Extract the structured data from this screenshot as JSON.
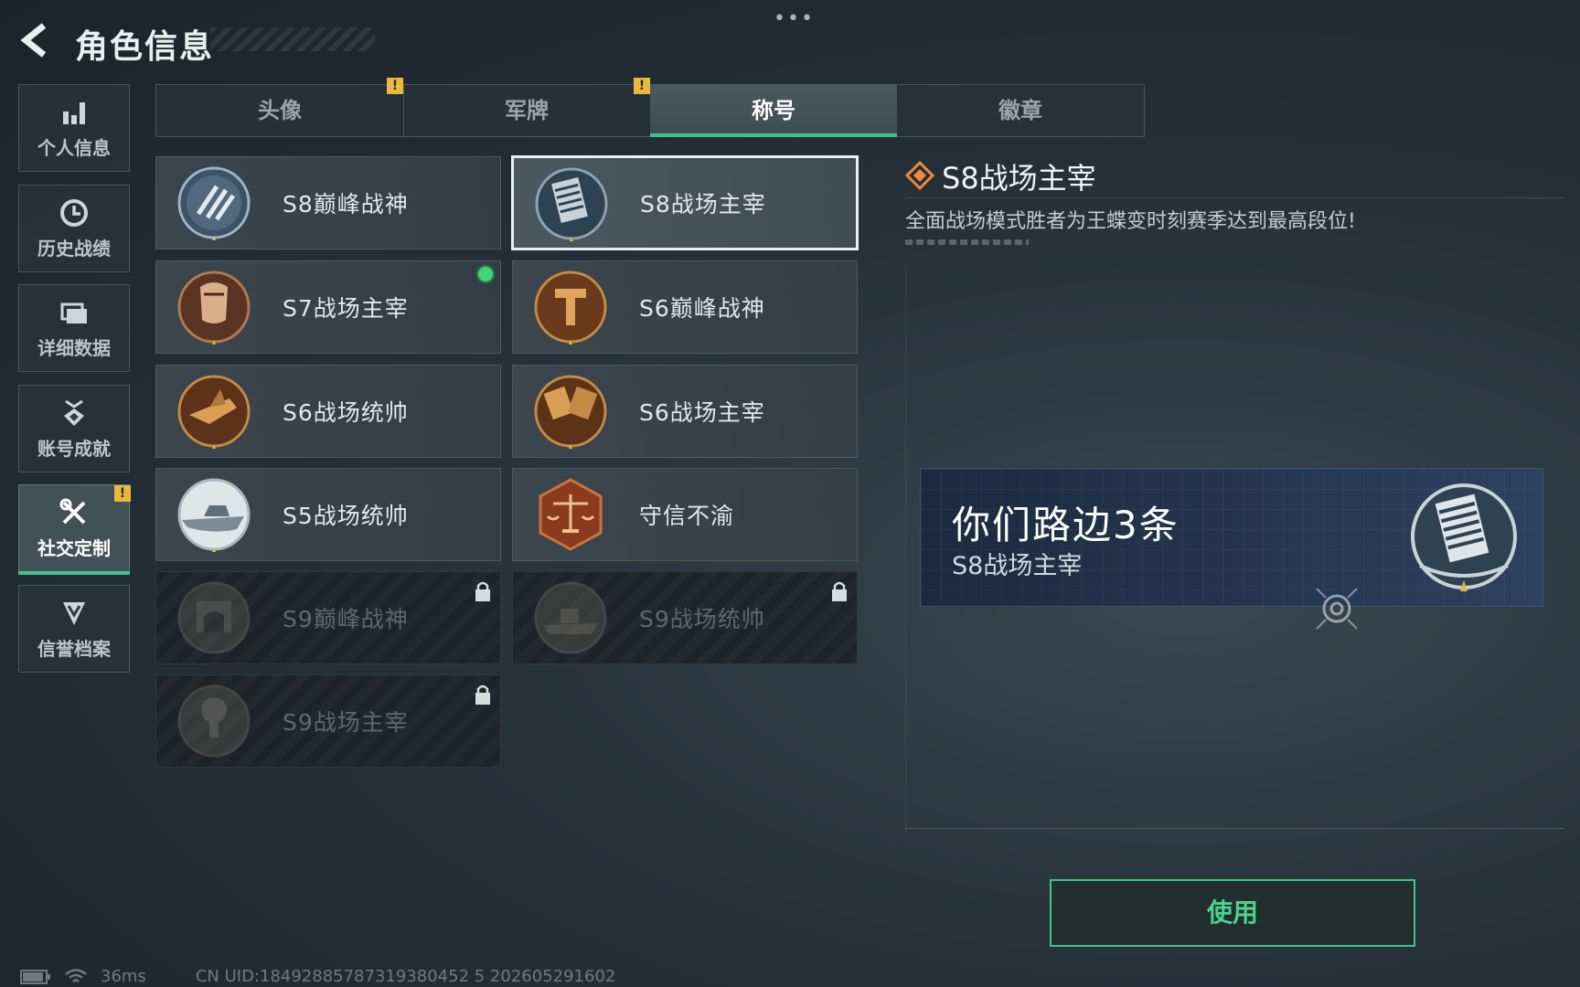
{
  "header": {
    "title": "角色信息",
    "more": "•••"
  },
  "sidebar": {
    "items": [
      {
        "label": "个人信息",
        "icon": "bar-chart-icon"
      },
      {
        "label": "历史战绩",
        "icon": "clock-icon"
      },
      {
        "label": "详细数据",
        "icon": "folder-icon"
      },
      {
        "label": "账号成就",
        "icon": "medal-icon"
      },
      {
        "label": "社交定制",
        "icon": "tools-icon",
        "active": true,
        "alert": "!"
      },
      {
        "label": "信誉档案",
        "icon": "shield-chevron-icon"
      }
    ]
  },
  "tabs": [
    {
      "label": "头像",
      "alert": "!"
    },
    {
      "label": "军牌",
      "alert": "!"
    },
    {
      "label": "称号",
      "active": true
    },
    {
      "label": "徽章"
    }
  ],
  "titles": [
    {
      "name": "S8巅峰战神",
      "emblem": "s8-peak-emblem",
      "state": "owned"
    },
    {
      "name": "S8战场主宰",
      "emblem": "s8-dominator-emblem",
      "state": "selected"
    },
    {
      "name": "S7战场主宰",
      "emblem": "s7-dominator-emblem",
      "state": "equipped"
    },
    {
      "name": "S6巅峰战神",
      "emblem": "s6-peak-emblem",
      "state": "owned"
    },
    {
      "name": "S6战场统帅",
      "emblem": "s6-commander-emblem",
      "state": "owned"
    },
    {
      "name": "S6战场主宰",
      "emblem": "s6-dominator-emblem",
      "state": "owned"
    },
    {
      "name": "S5战场统帅",
      "emblem": "s5-commander-emblem",
      "state": "owned"
    },
    {
      "name": "守信不渝",
      "emblem": "scales-emblem",
      "state": "owned"
    },
    {
      "name": "S9巅峰战神",
      "emblem": "s9-peak-emblem",
      "state": "locked"
    },
    {
      "name": "S9战场统帅",
      "emblem": "s9-commander-emblem",
      "state": "locked"
    },
    {
      "name": "S9战场主宰",
      "emblem": "s9-dominator-emblem",
      "state": "locked"
    }
  ],
  "detail": {
    "title": "S8战场主宰",
    "description": "全面战场模式胜者为王蝶变时刻赛季达到最高段位!"
  },
  "preview": {
    "player_name": "你们路边3条",
    "title": "S8战场主宰"
  },
  "use_button": "使用",
  "status": {
    "ping": "36ms",
    "uid": "CN UID:18492885787319380452 5 202605291602"
  },
  "colors": {
    "accent": "#3fc48a",
    "alert": "#e8b93a",
    "equipped": "#43d47a"
  }
}
